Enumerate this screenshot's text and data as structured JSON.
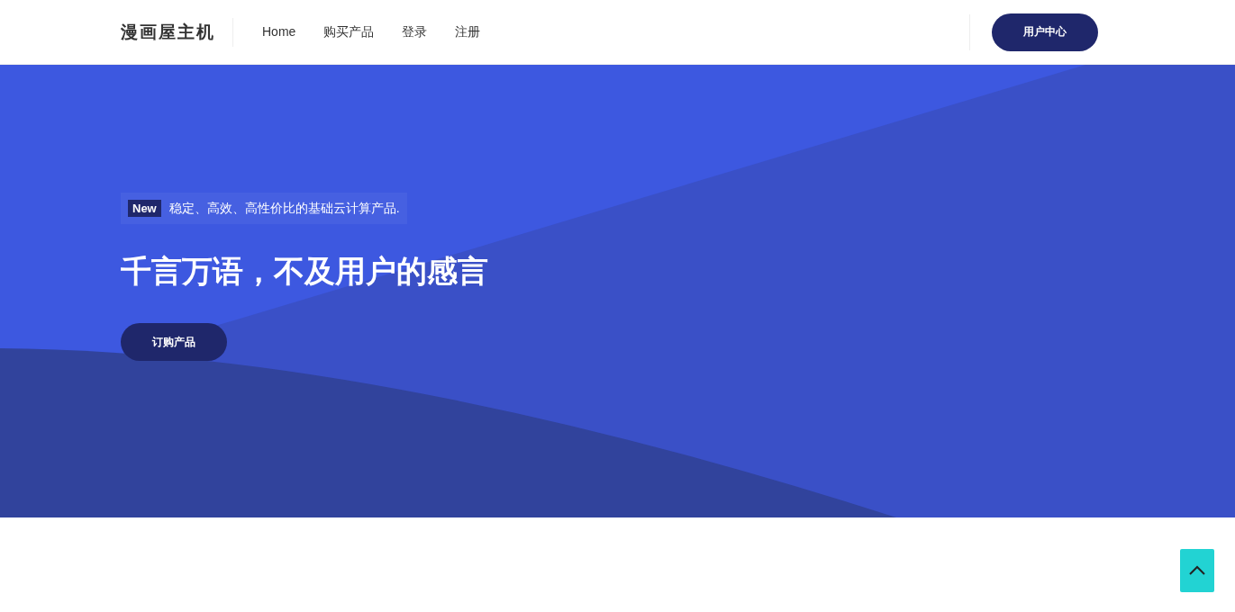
{
  "header": {
    "logo": "漫画屋主机",
    "nav": [
      {
        "label": "Home"
      },
      {
        "label": "购买产品"
      },
      {
        "label": "登录"
      },
      {
        "label": "注册"
      }
    ],
    "button": "用户中心"
  },
  "hero": {
    "badge": "New",
    "tagline": "稳定、高效、高性价比的基础云计算产品.",
    "title": "千言万语，不及用户的感言",
    "button": "订购产品"
  }
}
